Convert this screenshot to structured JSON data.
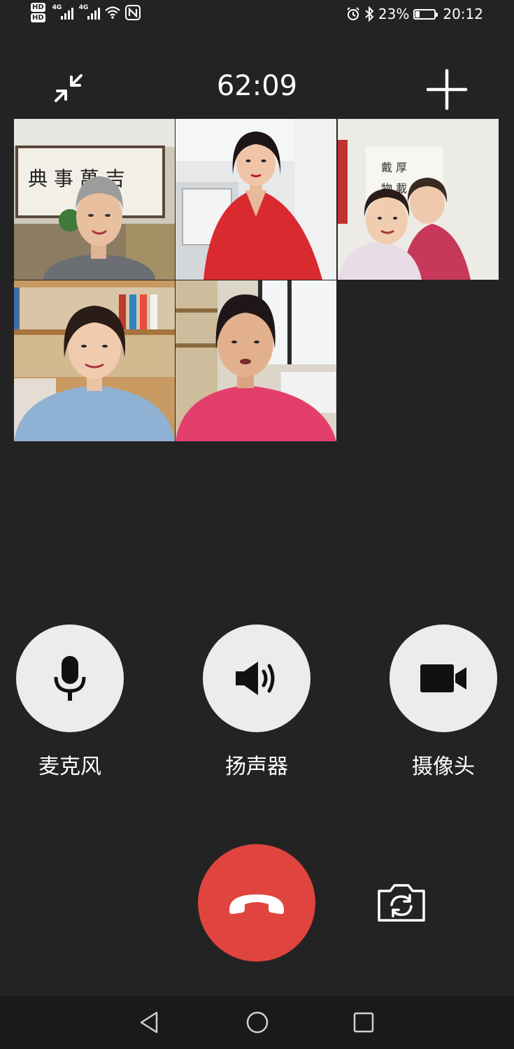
{
  "status_bar": {
    "hd1": "HD",
    "hd2": "HD",
    "net1": "4G",
    "net2": "4G",
    "battery_percent": "23%",
    "time": "20:12",
    "icons": [
      "signal-icon",
      "wifi-icon",
      "nfc-icon",
      "alarm-icon",
      "bluetooth-icon",
      "battery-icon"
    ],
    "battery_level": 0.23
  },
  "call": {
    "duration": "62:09",
    "minimize_icon": "minimize-icon",
    "add_icon": "add-participant-icon"
  },
  "participants": [
    {
      "id": "p1",
      "bg": "#c7c1b3",
      "shirt": "#6b6e73",
      "hair": "#9c9c9c"
    },
    {
      "id": "p2",
      "bg": "#e6e8ea",
      "shirt": "#d92a2f",
      "hair": "#1c1416"
    },
    {
      "id": "p3",
      "bg": "#ecebe6",
      "shirt": "#c7385a",
      "hair": "#2a1c16"
    },
    {
      "id": "p4",
      "bg": "#c89a62",
      "shirt": "#8fb1d3",
      "hair": "#2a1c16"
    },
    {
      "id": "p5",
      "bg": "#dcd6c9",
      "shirt": "#e33f6d",
      "hair": "#1f1717"
    }
  ],
  "controls": {
    "microphone": "麦克风",
    "speaker": "扬声器",
    "camera": "摄像头"
  },
  "actions": {
    "hangup_icon": "hang-up-icon",
    "flip_camera_icon": "switch-camera-icon"
  },
  "colors": {
    "background": "#232323",
    "control_circle": "#ececec",
    "hangup": "#e0443e",
    "nav_bar": "#1a1a1a"
  },
  "nav": {
    "icons": [
      "back-icon",
      "home-icon",
      "recents-icon"
    ]
  }
}
